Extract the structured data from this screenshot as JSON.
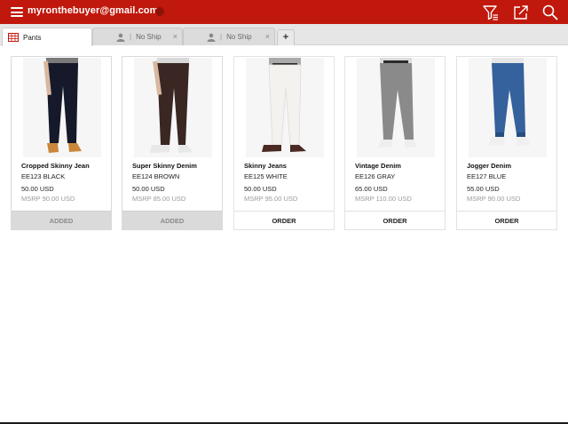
{
  "header": {
    "user_email": "myronthebuyer@gmail.com",
    "accent_color": "#c0180c",
    "icons": [
      "menu-icon",
      "filter-icon",
      "share-icon",
      "search-icon"
    ]
  },
  "tabs": [
    {
      "label": "Pants",
      "icon": "grid-icon",
      "active": true
    },
    {
      "label": "No Ship",
      "icon": "person-icon",
      "active": false
    },
    {
      "label": "No Ship",
      "icon": "person-icon",
      "active": false
    }
  ],
  "add_tab_label": "+",
  "tab_separator": "|",
  "tab_close": "×",
  "products": [
    {
      "name": "Cropped Skinny Jean",
      "sku": "EE123 BLACK",
      "price": "50.00 USD",
      "msrp": "MSRP 90.00 USD",
      "action": "ADDED",
      "added": true,
      "jean_color": "#15192a",
      "shoe_color": "#c8873a"
    },
    {
      "name": "Super Skinny Denim",
      "sku": "EE124 BROWN",
      "price": "50.00 USD",
      "msrp": "MSRP 85.00 USD",
      "action": "ADDED",
      "added": true,
      "jean_color": "#3a2622",
      "shoe_color": "#e8e8e8"
    },
    {
      "name": "Skinny Jeans",
      "sku": "EE125 WHITE",
      "price": "50.00 USD",
      "msrp": "MSRP 95.00 USD",
      "action": "ORDER",
      "added": false,
      "jean_color": "#f4f2ee",
      "shoe_color": "#4a2a22"
    },
    {
      "name": "Vintage Denim",
      "sku": "EE126 GRAY",
      "price": "65.00 USD",
      "msrp": "MSRP 110.00 USD",
      "action": "ORDER",
      "added": false,
      "jean_color": "#8a8a8a",
      "shoe_color": "#eeeeee"
    },
    {
      "name": "Jogger Denim",
      "sku": "EE127 BLUE",
      "price": "55.00 USD",
      "msrp": "MSRP 90.00 USD",
      "action": "ORDER",
      "added": false,
      "jean_color": "#35619c",
      "shoe_color": "#f0f0f0"
    }
  ]
}
